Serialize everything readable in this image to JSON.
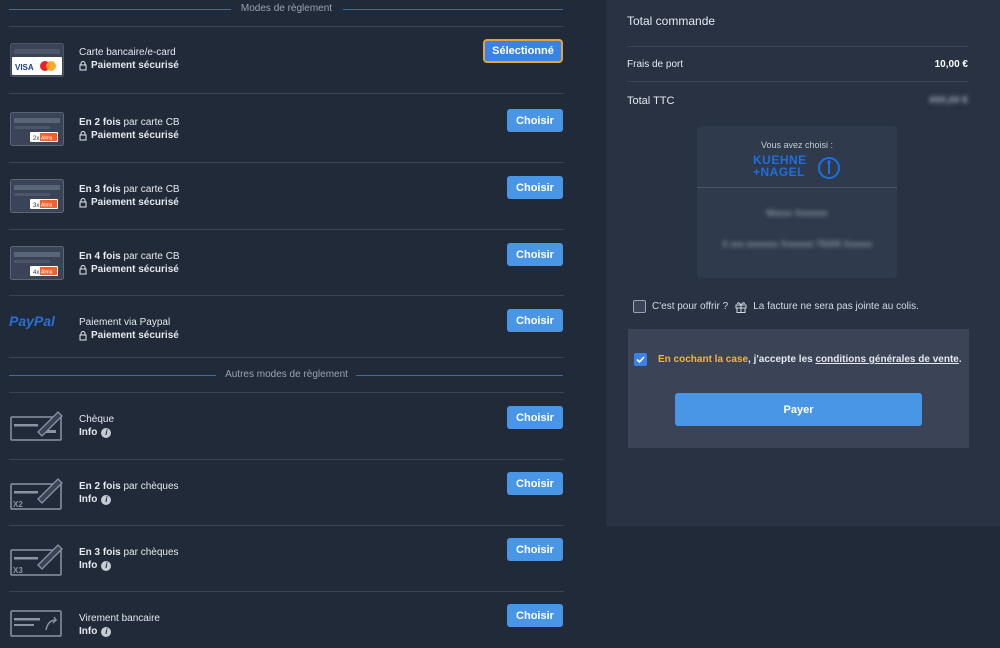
{
  "sections": {
    "cards_title": "Modes de règlement",
    "other_title": "Autres modes de règlement"
  },
  "card_methods": [
    {
      "brand_a": "VISA",
      "line1": "Carte bancaire/e-card",
      "bold": "",
      "secure": "Paiement sécurisé",
      "button": "Sélectionné"
    },
    {
      "badge": "2x",
      "badge_brand": "Alma",
      "bold": "En 2 fois",
      "line1": " par carte CB",
      "secure": "Paiement sécurisé",
      "button": "Choisir"
    },
    {
      "badge": "3x",
      "badge_brand": "Alma",
      "bold": "En 3 fois",
      "line1": " par carte CB",
      "secure": "Paiement sécurisé",
      "button": "Choisir"
    },
    {
      "badge": "4x",
      "badge_brand": "Alma",
      "bold": "En 4 fois",
      "line1": " par carte CB",
      "secure": "Paiement sécurisé",
      "button": "Choisir"
    },
    {
      "logo": "PayPal",
      "line1": "Paiement via Paypal",
      "bold": "",
      "secure": "Paiement sécurisé",
      "button": "Choisir"
    }
  ],
  "other_methods": [
    {
      "bold": "",
      "line1": "Chèque",
      "info": "Info",
      "button": "Choisir",
      "mark": ""
    },
    {
      "bold": "En 2 fois",
      "line1": " par chèques",
      "info": "Info",
      "button": "Choisir",
      "mark": "X2"
    },
    {
      "bold": "En 3 fois",
      "line1": " par chèques",
      "info": "Info",
      "button": "Choisir",
      "mark": "X3"
    },
    {
      "bold": "",
      "line1": "Virement bancaire",
      "info": "Info",
      "button": "Choisir",
      "mark": ""
    }
  ],
  "summary": {
    "title": "Total commande",
    "shipping_label": "Frais de port",
    "shipping_value": "10,00 €",
    "total_label": "Total TTC",
    "total_value": "###,## €",
    "carrier_chosen": "Vous avez choisi :",
    "carrier_name_1": "KUEHNE",
    "carrier_name_2": "+NAGEL",
    "carrier_blur_1": "Mxxxx Xxxxxxx",
    "carrier_blur_2": "X xxx xxxxxxx Xxxxxxx 75000 Xxxxxx",
    "gift_label": "C'est pour offrir ?",
    "invoice_note": "La facture ne sera pas jointe au colis.",
    "accept_highlight": "En cochant la case",
    "accept_mid": ", j'accepte les ",
    "accept_link": "conditions générales de vente",
    "accept_end": ".",
    "pay_button": "Payer"
  },
  "colors": {
    "background": "#212a39",
    "panel": "#283243",
    "button": "#4a96e6",
    "accent_orange": "#f2b53a",
    "kn_blue": "#1e6fe0"
  }
}
